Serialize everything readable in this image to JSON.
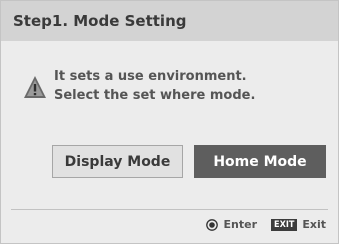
{
  "dialog": {
    "title": "Step1. Mode Setting",
    "message_line1": "It sets a use environment.",
    "message_line2": "Select the set where mode.",
    "buttons": {
      "display_mode": "Display Mode",
      "home_mode": "Home Mode"
    },
    "footer": {
      "enter_label": "Enter",
      "exit_key": "EXIT",
      "exit_label": "Exit"
    },
    "icons": {
      "warning": "warning-icon",
      "enter": "enter-icon"
    },
    "colors": {
      "title_bar": "#d3d3d3",
      "background": "#ececec",
      "selected_button": "#5e5e5e"
    }
  }
}
